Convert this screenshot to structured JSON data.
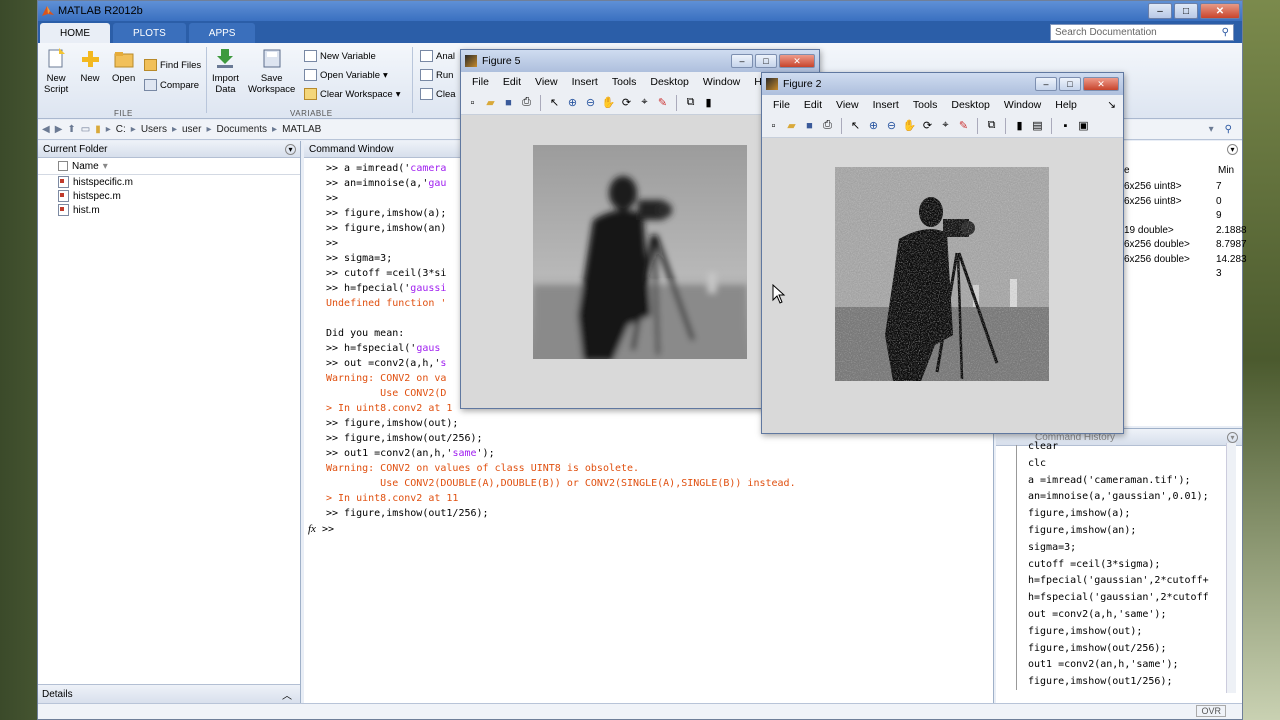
{
  "app": {
    "title": "MATLAB R2012b",
    "min": "–",
    "max": "□",
    "close": "✕"
  },
  "tabs": [
    "HOME",
    "PLOTS",
    "APPS"
  ],
  "search_doc": {
    "placeholder": "Search Documentation"
  },
  "ribbon": {
    "new_script": "New\nScript",
    "new": "New",
    "open": "Open",
    "find_files": "Find Files",
    "compare": "Compare",
    "import_data": "Import\nData",
    "save_workspace": "Save\nWorkspace",
    "new_variable": "New Variable",
    "open_variable": "Open Variable",
    "clear_workspace": "Clear Workspace",
    "analyze": "Anal",
    "run": "Run",
    "clear_cmd": "Clea",
    "sect_file": "FILE",
    "sect_variable": "VARIABLE"
  },
  "address": {
    "crumbs": [
      "C:",
      "Users",
      "user",
      "Documents",
      "MATLAB"
    ]
  },
  "current_folder": {
    "title": "Current Folder",
    "col_name": "Name",
    "sort_arrow": "▾",
    "files": [
      "histspecific.m",
      "histspec.m",
      "hist.m"
    ],
    "details": "Details",
    "details_toggle": "︿"
  },
  "command_window": {
    "title": "Command Window",
    "fx": "fx",
    "prompt": ">>",
    "lines": [
      {
        "t": ">> a =imread('",
        "s": "camera",
        "k": "n"
      },
      {
        "t": ">> an=imnoise(a,'",
        "s": "gau",
        "k": "n"
      },
      {
        "t": ">>",
        "s": "",
        "k": "n"
      },
      {
        "t": ">> figure,imshow(a);",
        "s": "",
        "k": "n"
      },
      {
        "t": ">> figure,imshow(an)",
        "s": "",
        "k": "n"
      },
      {
        "t": ">>",
        "s": "",
        "k": "n"
      },
      {
        "t": ">> sigma=3;",
        "s": "",
        "k": "n"
      },
      {
        "t": ">> cutoff =ceil(3*si",
        "s": "",
        "k": "n"
      },
      {
        "t": ">> h=fpecial('",
        "s": "gaussi",
        "k": "n"
      },
      {
        "t": "Undefined function '",
        "s": "",
        "k": "err"
      },
      {
        "t": "",
        "s": "",
        "k": "n"
      },
      {
        "t": "Did you mean:",
        "s": "",
        "k": "n"
      },
      {
        "t": ">> h=fspecial('",
        "s": "gaus",
        "k": "n"
      },
      {
        "t": ">> out =conv2(a,h,'",
        "s": "s",
        "k": "n"
      },
      {
        "t": "Warning: CONV2 on va",
        "s": "",
        "k": "err"
      },
      {
        "t": "         Use CONV2(D",
        "s": "",
        "k": "err"
      },
      {
        "t": "> In uint8.conv2 at 1",
        "s": "",
        "k": "err"
      },
      {
        "t": ">> figure,imshow(out);",
        "s": "",
        "k": "n"
      },
      {
        "t": ">> figure,imshow(out/256);",
        "s": "",
        "k": "n"
      },
      {
        "t": ">> out1 =conv2(an,h,'",
        "s": "same",
        "k": "n",
        "tail": "');"
      },
      {
        "t": "Warning: CONV2 on values of class UINT8 is obsolete.",
        "s": "",
        "k": "err"
      },
      {
        "t": "         Use CONV2(DOUBLE(A),DOUBLE(B)) or CONV2(SINGLE(A),SINGLE(B)) instead.",
        "s": "",
        "k": "err"
      },
      {
        "t": "> In uint8.conv2 at 11",
        "s": "",
        "k": "err"
      },
      {
        "t": ">> figure,imshow(out1/256);",
        "s": "",
        "k": "n"
      }
    ]
  },
  "workspace": {
    "col_value": "e",
    "col_min": "Min",
    "rows": [
      {
        "value": "6x256 uint8>",
        "min": "7"
      },
      {
        "value": "6x256 uint8>",
        "min": "0"
      },
      {
        "value": "",
        "min": "9"
      },
      {
        "value": "19 double>",
        "min": "2.1888"
      },
      {
        "value": "6x256 double>",
        "min": "8.7987"
      },
      {
        "value": "6x256 double>",
        "min": "14.283"
      },
      {
        "value": "",
        "min": "3"
      }
    ]
  },
  "history": {
    "title": "Command History",
    "lines": [
      "clear",
      "clc",
      "a =imread('cameraman.tif');",
      "an=imnoise(a,'gaussian',0.01);",
      "figure,imshow(a);",
      "figure,imshow(an);",
      "sigma=3;",
      "cutoff =ceil(3*sigma);",
      "h=fpecial('gaussian',2*cutoff+",
      "h=fspecial('gaussian',2*cutoff",
      "out =conv2(a,h,'same');",
      "figure,imshow(out);",
      "figure,imshow(out/256);",
      "out1 =conv2(an,h,'same');",
      "figure,imshow(out1/256);"
    ]
  },
  "status": {
    "ovr": "OVR"
  },
  "figure5": {
    "title": "Figure 5",
    "menu": [
      "File",
      "Edit",
      "View",
      "Insert",
      "Tools",
      "Desktop",
      "Window",
      "Help"
    ]
  },
  "figure2": {
    "title": "Figure 2",
    "menu": [
      "File",
      "Edit",
      "View",
      "Insert",
      "Tools",
      "Desktop",
      "Window",
      "Help"
    ],
    "menu_arrow": "↘"
  }
}
